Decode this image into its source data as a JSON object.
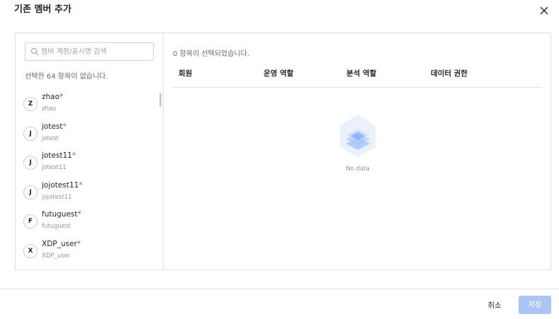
{
  "dialog": {
    "title": "기존 멤버 추가"
  },
  "icons": {
    "close": "close-icon",
    "search": "search-icon",
    "empty": "empty-data-icon"
  },
  "search": {
    "placeholder": "멤버 계정/표시명 검색",
    "value": ""
  },
  "left_panel": {
    "selected_info": "선택한 64 항목이 없습니다."
  },
  "members": [
    {
      "initial": "Z",
      "name": "zhao",
      "marker": "*",
      "account": "zhao"
    },
    {
      "initial": "J",
      "name": "jotest",
      "marker": "*",
      "account": "jotest"
    },
    {
      "initial": "J",
      "name": "jotest11",
      "marker": "*",
      "account": "jotest11"
    },
    {
      "initial": "J",
      "name": "jojotest11",
      "marker": "*",
      "account": "jojotest11"
    },
    {
      "initial": "F",
      "name": "futuguest",
      "marker": "*",
      "account": "futuguest"
    },
    {
      "initial": "X",
      "name": "XDP_user",
      "marker": "*",
      "account": "XDP_user"
    }
  ],
  "right_panel": {
    "selected_count": "0 항목이 선택되었습니다.",
    "columns": [
      "회원",
      "운영 역할",
      "분석 역할",
      "데이터 권한"
    ],
    "empty_text": "No data"
  },
  "footer": {
    "cancel_label": "취소",
    "save_label": "저장"
  },
  "colors": {
    "accent": "#3370ff",
    "save_disabled": "#a9c4f7",
    "border": "#dee0e3",
    "empty_icon_light": "#d6e4fb",
    "empty_icon_mid": "#a9c4f7",
    "empty_icon_dark": "#6e9ef5"
  }
}
